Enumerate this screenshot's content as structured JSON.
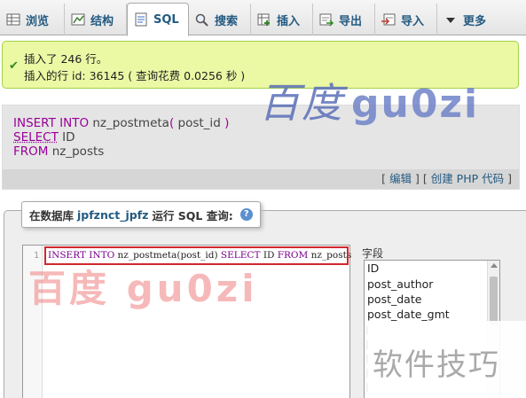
{
  "tabs": [
    {
      "label": "浏览",
      "icon": "browse-icon"
    },
    {
      "label": "结构",
      "icon": "structure-icon"
    },
    {
      "label": "SQL",
      "icon": "sql-icon"
    },
    {
      "label": "搜索",
      "icon": "search-icon"
    },
    {
      "label": "插入",
      "icon": "insert-icon"
    },
    {
      "label": "导出",
      "icon": "export-icon"
    },
    {
      "label": "导入",
      "icon": "import-icon"
    },
    {
      "label": "更多",
      "icon": "chevron-down-icon"
    }
  ],
  "message": {
    "line1": "插入了 246 行。",
    "line2": "插入的行 id: 36145 ( 查询花费 0.0256 秒 )"
  },
  "query": {
    "insert_kw": "INSERT INTO",
    "table": "nz_postmeta",
    "paren_open": "(",
    "column": "post_id",
    "paren_close": ")",
    "select_kw": "SELECT",
    "select_col": "ID",
    "from_kw": "FROM",
    "from_table": "nz_posts"
  },
  "actions": {
    "open1": "[",
    "edit": "编辑",
    "sep": "] [",
    "create_php": "创建 PHP 代码",
    "close": "]"
  },
  "run_sql": {
    "prefix": "在数据库",
    "database": "jpfznct_jpfz",
    "suffix": "运行 SQL 查询:",
    "help": "?"
  },
  "editor": {
    "line_number": "1",
    "kw1": "INSERT INTO",
    "part1": "nz_postmeta(post_id)",
    "kw2": "SELECT",
    "part2": "ID",
    "kw3": "FROM",
    "part3": "nz_posts"
  },
  "fields": {
    "label": "字段",
    "items": [
      "ID",
      "post_author",
      "post_date",
      "post_date_gmt"
    ]
  },
  "watermarks": {
    "top": "百度",
    "top_latin": "gu0zi",
    "middle": "百度 gu0zi",
    "corner": "软件技巧"
  },
  "colors": {
    "keyword": "#990099",
    "link": "#235a81",
    "success_bg": "#ebf8a4",
    "highlight_border": "#d0282e"
  }
}
